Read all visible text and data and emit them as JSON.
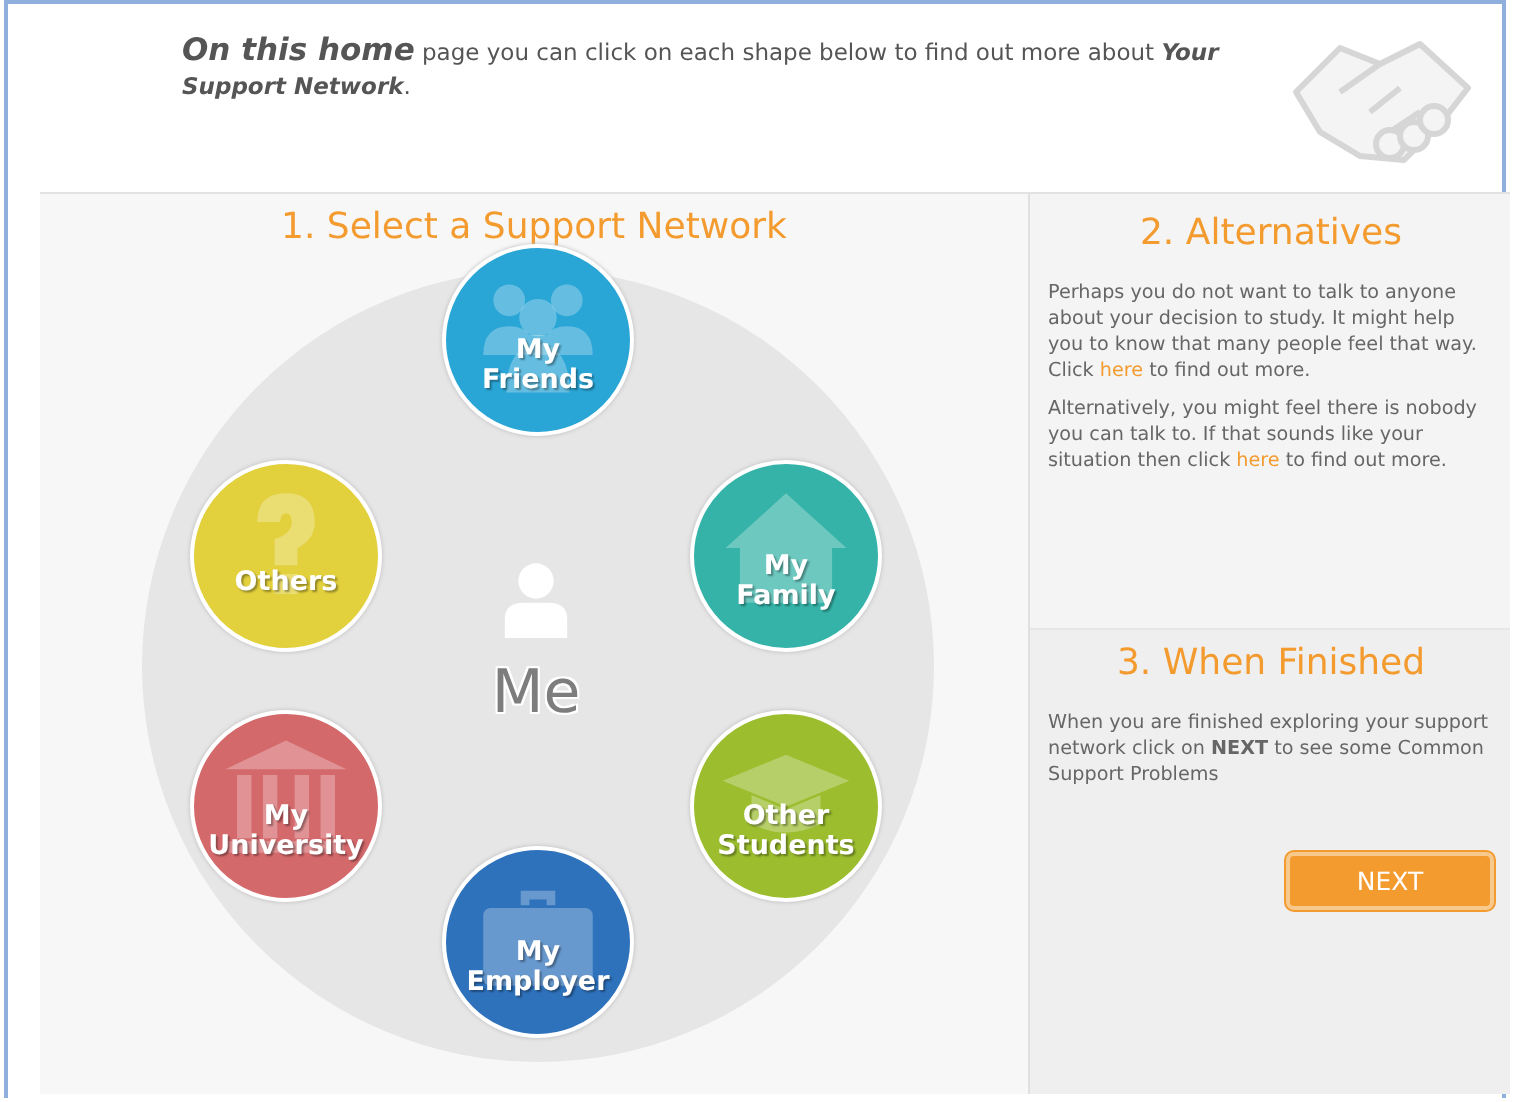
{
  "intro": {
    "lead": "On this home",
    "text": " page you can click on each shape below to find out more about **Your Support Network**."
  },
  "network": {
    "title": "1. Select a Support Network",
    "center": "Me",
    "nodes": [
      {
        "kind": "people",
        "lines": [
          "My",
          "Friends"
        ],
        "color": "#2aa6d6"
      },
      {
        "kind": "question",
        "lines": [
          "Others"
        ],
        "color": "#e2d03c"
      },
      {
        "kind": "house",
        "lines": [
          "My",
          "Family"
        ],
        "color": "#35b3a8"
      },
      {
        "kind": "columns",
        "lines": [
          "My",
          "University"
        ],
        "color": "#d4696c"
      },
      {
        "kind": "cap",
        "lines": [
          "Other",
          "Students"
        ],
        "color": "#9bbd2e"
      },
      {
        "kind": "case",
        "lines": [
          "My",
          "Employer"
        ],
        "color": "#2f72bc"
      }
    ]
  },
  "alternatives": {
    "title": "2. Alternatives",
    "paragraphs": [
      {
        "before": "Perhaps you do not want to talk to anyone about your decision to study. It might help you to know that many people feel that way. Click ",
        "link": "here",
        "after": " to find out more."
      },
      {
        "before": "Alternatively, you might feel there is nobody you can talk to. If that sounds like your situation then click ",
        "link": "here",
        "after": " to find out more."
      }
    ]
  },
  "finished": {
    "title": "3. When Finished",
    "text": "When you are finished exploring your support network click on **NEXT** to see some Common Support Problems",
    "button": "NEXT"
  }
}
